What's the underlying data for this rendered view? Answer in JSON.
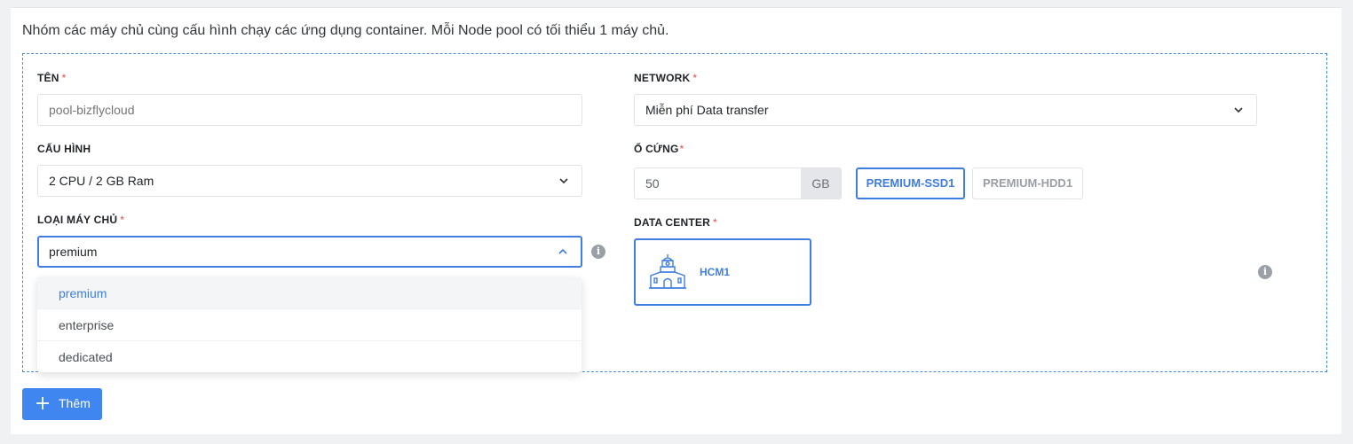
{
  "description": "Nhóm các máy chủ cùng cấu hình chạy các ứng dụng container. Mỗi Node pool có tối thiểu 1 máy chủ.",
  "required_mark": "*",
  "fields": {
    "name": {
      "label": "TÊN",
      "placeholder": "pool-bizflycloud",
      "value": ""
    },
    "config": {
      "label": "CẤU HÌNH",
      "value": "2 CPU / 2 GB Ram"
    },
    "server_type": {
      "label": "LOẠI MÁY CHỦ",
      "value": "premium",
      "options": [
        "premium",
        "enterprise",
        "dedicated"
      ],
      "highlighted_option": "premium"
    },
    "network": {
      "label": "NETWORK",
      "value": "Miễn phí Data transfer"
    },
    "disk": {
      "label": "Ổ CỨNG",
      "value": "50",
      "unit": "GB",
      "types": [
        {
          "label": "PREMIUM-SSD1",
          "selected": true
        },
        {
          "label": "PREMIUM-HDD1",
          "selected": false
        }
      ]
    },
    "data_center": {
      "label": "DATA CENTER",
      "selected": "HCM1",
      "icon": "building-icon"
    }
  },
  "info_icon_glyph": "i",
  "add_button": {
    "label": "Thêm",
    "icon": "plus-icon"
  },
  "colors": {
    "accent": "#3f7de0",
    "button": "#3f86f0",
    "required": "#e5484d",
    "border": "#dfe2e6"
  }
}
